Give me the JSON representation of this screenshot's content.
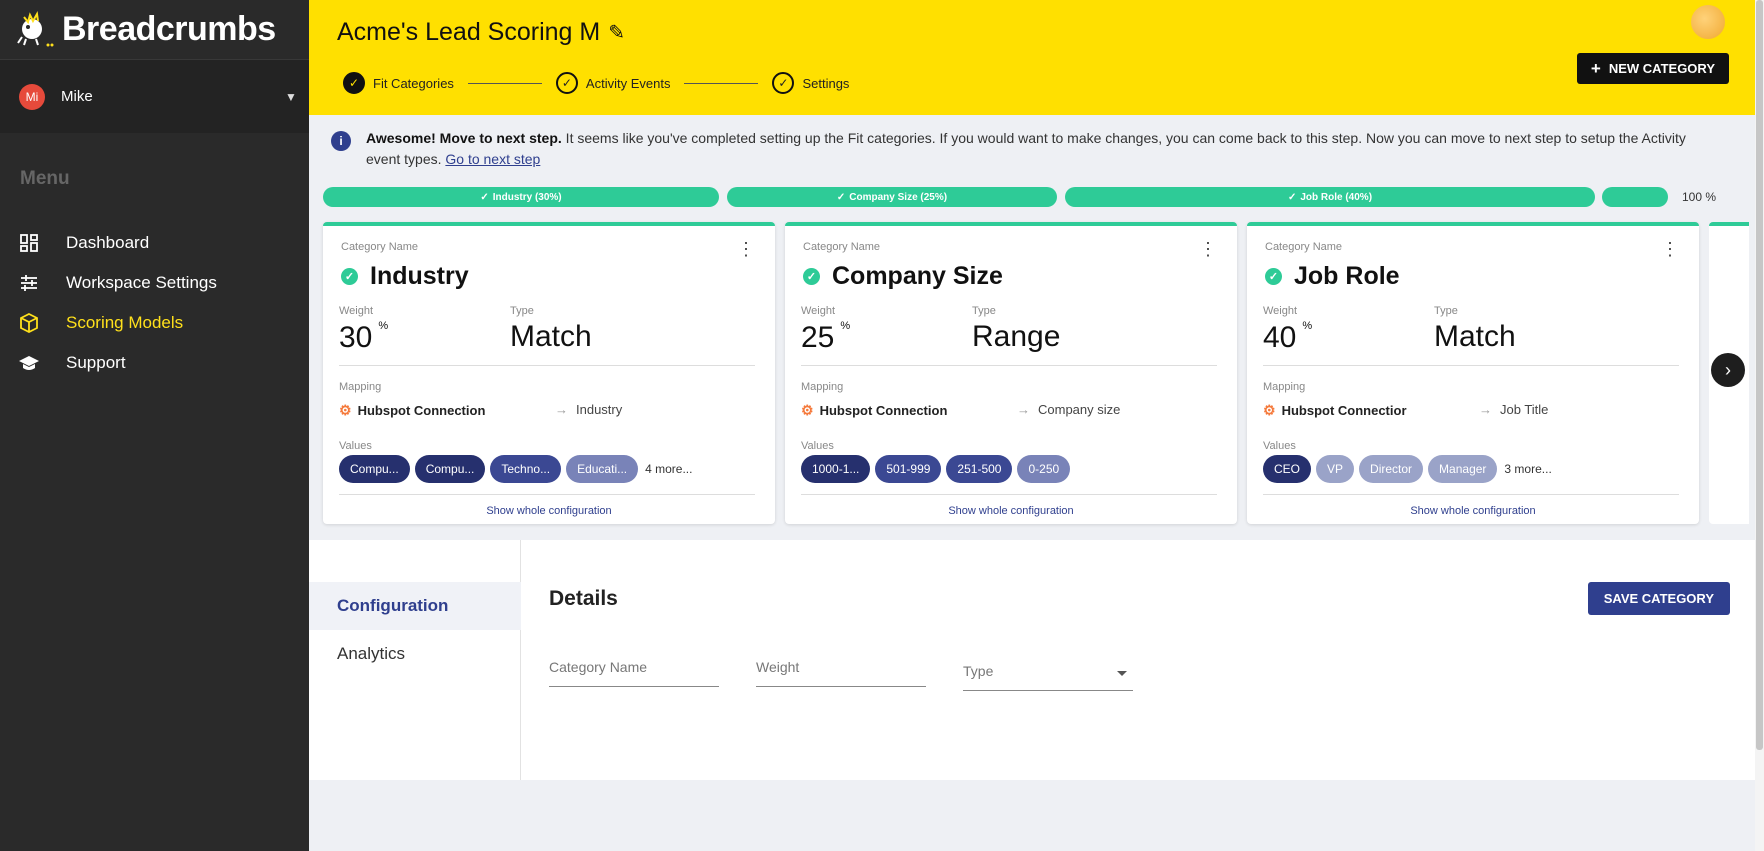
{
  "sidebar": {
    "brand": "Breadcrumbs",
    "user": {
      "initials": "Mi",
      "name": "Mike"
    },
    "menu_label": "Menu",
    "items": [
      {
        "label": "Dashboard",
        "icon": "dashboard-icon"
      },
      {
        "label": "Workspace Settings",
        "icon": "sliders-icon"
      },
      {
        "label": "Scoring Models",
        "icon": "cube-icon",
        "active": true
      },
      {
        "label": "Support",
        "icon": "graduation-cap-icon"
      }
    ]
  },
  "header": {
    "title": "Acme's Lead Scoring M",
    "steps": [
      "Fit Categories",
      "Activity Events",
      "Settings"
    ],
    "new_category": "NEW CATEGORY"
  },
  "info": {
    "bold": "Awesome! Move to next step.",
    "text": " It seems like you've completed setting up the Fit categories. If you would want to make changes, you can come back to this step. Now you can move to next step to setup the Activity event types. ",
    "link": "Go to next step"
  },
  "progress": {
    "segments": [
      "Industry (30%)",
      "Company Size (25%)",
      "Job Role (40%)"
    ],
    "total": "100 %"
  },
  "cards": [
    {
      "label": "Category Name",
      "name": "Industry",
      "weight_label": "Weight",
      "weight": "30",
      "unit": "%",
      "type_label": "Type",
      "type": "Match",
      "mapping_label": "Mapping",
      "connection": "Hubspot Connection",
      "field": "Industry",
      "values_label": "Values",
      "values": [
        "Compu...",
        "Compu...",
        "Techno...",
        "Educati..."
      ],
      "more": "4 more...",
      "show": "Show whole configuration"
    },
    {
      "label": "Category Name",
      "name": "Company Size",
      "weight_label": "Weight",
      "weight": "25",
      "unit": "%",
      "type_label": "Type",
      "type": "Range",
      "mapping_label": "Mapping",
      "connection": "Hubspot Connection",
      "field": "Company size",
      "values_label": "Values",
      "values": [
        "1000-1...",
        "501-999",
        "251-500",
        "0-250"
      ],
      "more": "",
      "show": "Show whole configuration"
    },
    {
      "label": "Category Name",
      "name": "Job Role",
      "weight_label": "Weight",
      "weight": "40",
      "unit": "%",
      "type_label": "Type",
      "type": "Match",
      "mapping_label": "Mapping",
      "connection": "Hubspot Connectior",
      "field": "Job Title",
      "values_label": "Values",
      "values": [
        "CEO",
        "VP",
        "Director",
        "Manager"
      ],
      "more": "3 more...",
      "show": "Show whole configuration"
    }
  ],
  "panel": {
    "tabs": [
      "Configuration",
      "Analytics"
    ],
    "details_title": "Details",
    "save": "SAVE CATEGORY",
    "fields": {
      "name": "Category Name",
      "weight": "Weight",
      "type": "Type"
    }
  }
}
